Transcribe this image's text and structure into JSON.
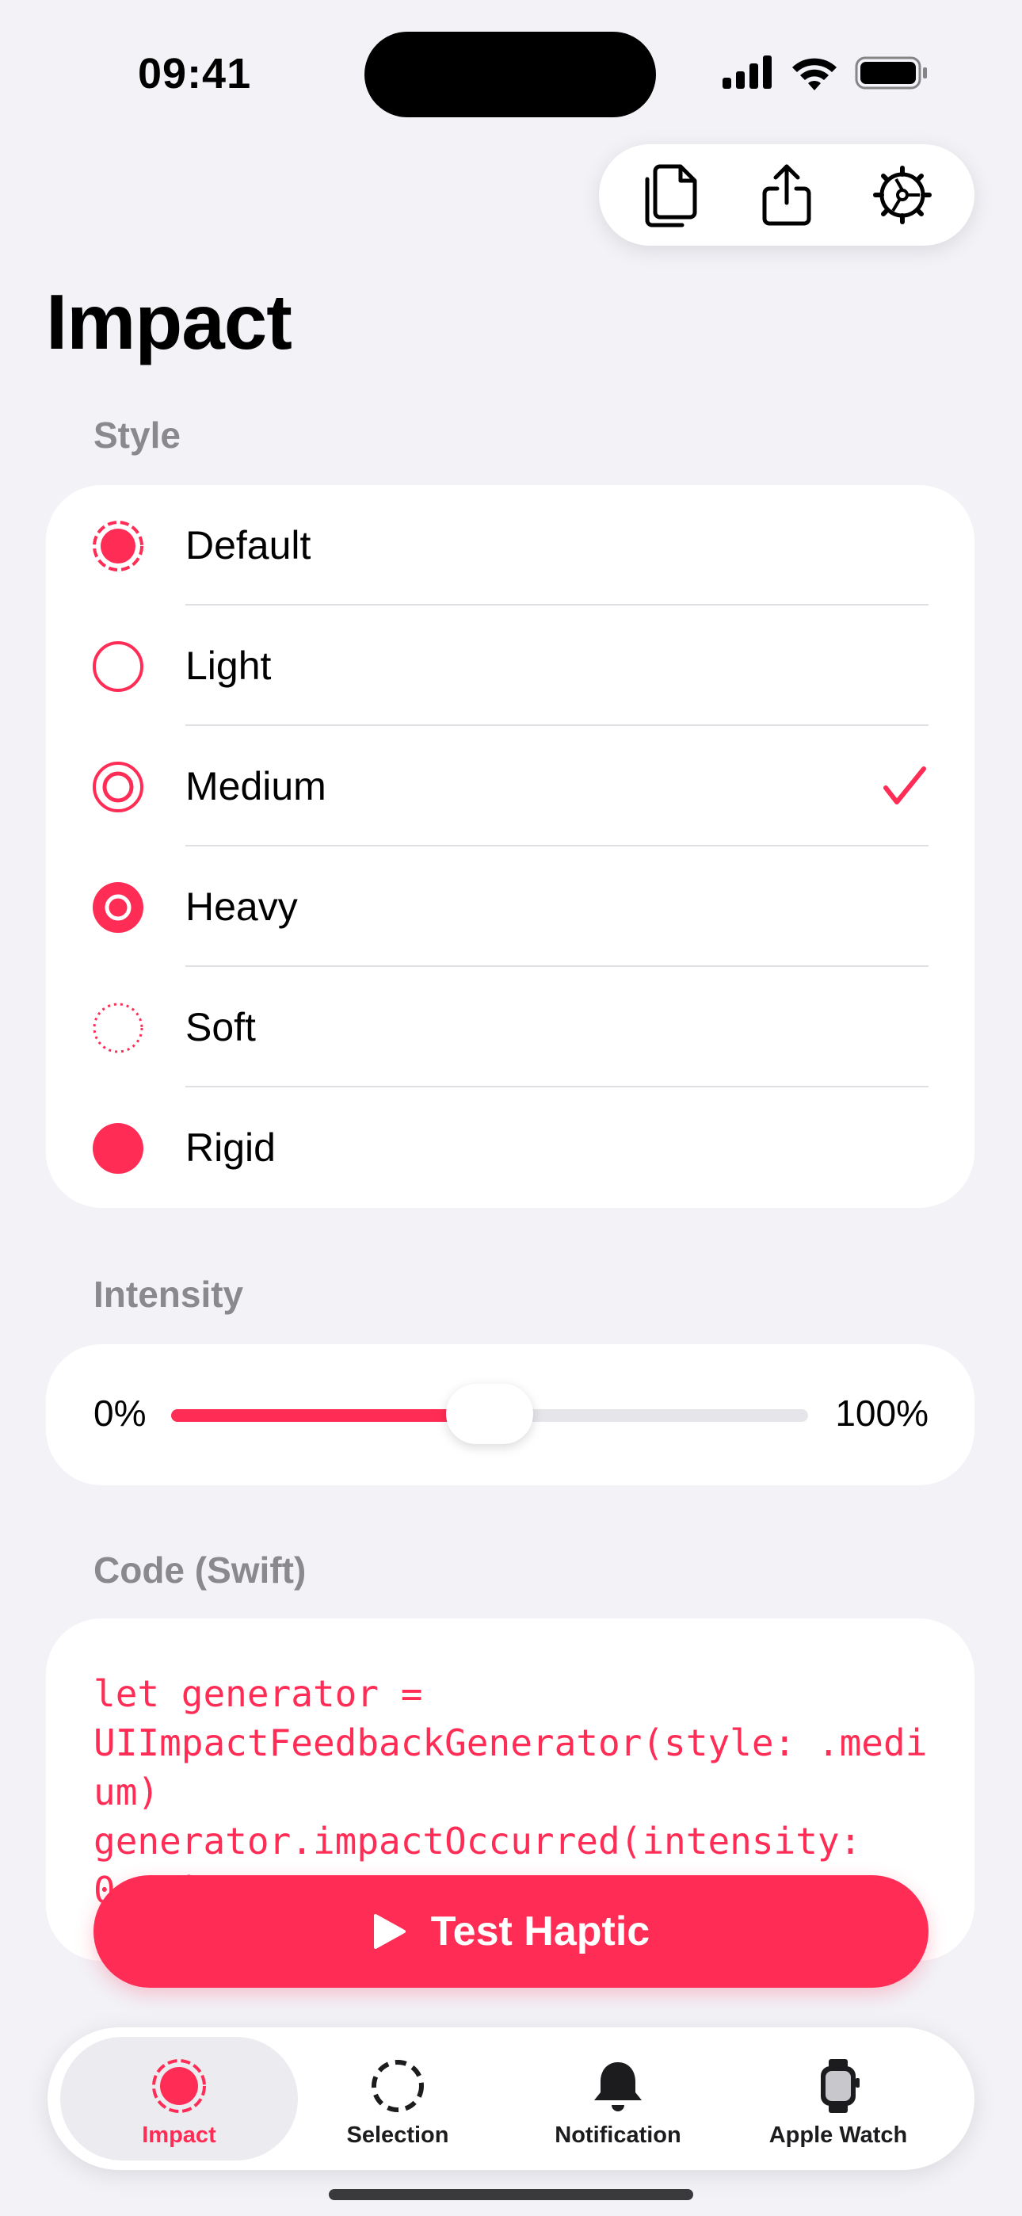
{
  "status_bar": {
    "time": "09:41"
  },
  "toolbar": {
    "actions": [
      "copy-icon",
      "share-icon",
      "settings-icon"
    ]
  },
  "page_title": "Impact",
  "style_section": {
    "label": "Style",
    "options": [
      {
        "label": "Default",
        "icon": "dashed-radio-icon"
      },
      {
        "label": "Light",
        "icon": "ring-radio-icon"
      },
      {
        "label": "Medium",
        "icon": "double-ring-radio-icon"
      },
      {
        "label": "Heavy",
        "icon": "filled-ring-radio-icon"
      },
      {
        "label": "Soft",
        "icon": "dotted-radio-icon"
      },
      {
        "label": "Rigid",
        "icon": "solid-radio-icon"
      }
    ],
    "selected": "Medium"
  },
  "intensity_section": {
    "label": "Intensity",
    "min_label": "0%",
    "max_label": "100%",
    "value": 0.5
  },
  "code_section": {
    "label": "Code (Swift)",
    "code": "let generator = \nUIImpactFeedbackGenerator(style: .medium)\ngenerator.impactOccurred(intensity: \n0.50)"
  },
  "test_button": {
    "label": "Test Haptic"
  },
  "tabbar": {
    "tabs": [
      {
        "label": "Impact",
        "active": true
      },
      {
        "label": "Selection",
        "active": false
      },
      {
        "label": "Notification",
        "active": false
      },
      {
        "label": "Apple Watch",
        "active": false
      }
    ]
  },
  "colors": {
    "accent": "#FF2D55",
    "background": "#F2F2F7",
    "secondary_text": "#8A8A8E"
  }
}
